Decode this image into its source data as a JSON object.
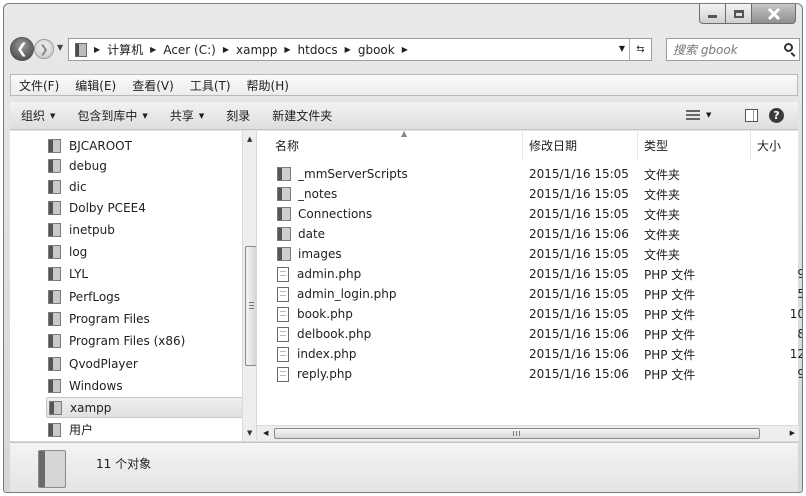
{
  "window": {
    "caption_buttons": [
      "minimize",
      "maximize",
      "close"
    ]
  },
  "address": {
    "crumbs": [
      "计算机",
      "Acer (C:)",
      "xampp",
      "htdocs",
      "gbook"
    ],
    "search_placeholder": "搜索 gbook"
  },
  "menu": {
    "items": [
      "文件(F)",
      "编辑(E)",
      "查看(V)",
      "工具(T)",
      "帮助(H)"
    ]
  },
  "toolbar": {
    "organize": "组织",
    "include_in_library": "包含到库中",
    "share": "共享",
    "burn": "刻录",
    "new_folder": "新建文件夹"
  },
  "nav": {
    "items": [
      {
        "label": "BJCAROOT",
        "icon": "folder-icon"
      },
      {
        "label": "debug",
        "icon": "locked-folder-icon"
      },
      {
        "label": "dic",
        "icon": "folder-icon"
      },
      {
        "label": "Dolby PCEE4",
        "icon": "folder-icon"
      },
      {
        "label": "inetpub",
        "icon": "folder-icon"
      },
      {
        "label": "log",
        "icon": "folder-icon"
      },
      {
        "label": "LYL",
        "icon": "folder-icon"
      },
      {
        "label": "PerfLogs",
        "icon": "folder-icon"
      },
      {
        "label": "Program Files",
        "icon": "folder-icon"
      },
      {
        "label": "Program Files (x86)",
        "icon": "folder-icon"
      },
      {
        "label": "QvodPlayer",
        "icon": "folder-icon"
      },
      {
        "label": "Windows",
        "icon": "folder-icon"
      },
      {
        "label": "xampp",
        "icon": "folder-icon",
        "selected": true
      },
      {
        "label": "用户",
        "icon": "folder-icon"
      }
    ]
  },
  "files": {
    "columns": {
      "name": "名称",
      "date": "修改日期",
      "type": "类型",
      "size": "大小"
    },
    "rows": [
      {
        "name": "_mmServerScripts",
        "date": "2015/1/16 15:05",
        "type": "文件夹",
        "size": "",
        "icon": "folder-icon"
      },
      {
        "name": "_notes",
        "date": "2015/1/16 15:05",
        "type": "文件夹",
        "size": "",
        "icon": "folder-icon"
      },
      {
        "name": "Connections",
        "date": "2015/1/16 15:05",
        "type": "文件夹",
        "size": "",
        "icon": "folder-icon"
      },
      {
        "name": "date",
        "date": "2015/1/16 15:06",
        "type": "文件夹",
        "size": "",
        "icon": "folder-icon"
      },
      {
        "name": "images",
        "date": "2015/1/16 15:05",
        "type": "文件夹",
        "size": "",
        "icon": "folder-icon"
      },
      {
        "name": "admin.php",
        "date": "2015/1/16 15:05",
        "type": "PHP 文件",
        "size": "9",
        "icon": "php-file-icon"
      },
      {
        "name": "admin_login.php",
        "date": "2015/1/16 15:05",
        "type": "PHP 文件",
        "size": "5",
        "icon": "php-file-icon"
      },
      {
        "name": "book.php",
        "date": "2015/1/16 15:05",
        "type": "PHP 文件",
        "size": "10",
        "icon": "php-file-icon"
      },
      {
        "name": "delbook.php",
        "date": "2015/1/16 15:06",
        "type": "PHP 文件",
        "size": "8",
        "icon": "php-file-icon"
      },
      {
        "name": "index.php",
        "date": "2015/1/16 15:06",
        "type": "PHP 文件",
        "size": "12",
        "icon": "php-file-icon"
      },
      {
        "name": "reply.php",
        "date": "2015/1/16 15:06",
        "type": "PHP 文件",
        "size": "9",
        "icon": "php-file-icon"
      }
    ]
  },
  "details": {
    "count_text": "11 个对象"
  }
}
